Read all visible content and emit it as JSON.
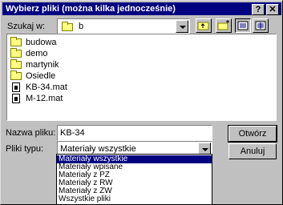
{
  "window": {
    "title": "Wybierz pliki (można kilka jednocześnie)",
    "help_btn": "?",
    "close_btn": "✕"
  },
  "lookin": {
    "label": "Szukaj w:",
    "value": "b"
  },
  "files": [
    {
      "name": "budowa",
      "type": "folder"
    },
    {
      "name": "demo",
      "type": "folder"
    },
    {
      "name": "martynik",
      "type": "folder"
    },
    {
      "name": "Osiedle",
      "type": "folder"
    },
    {
      "name": "KB-34.mat",
      "type": "file"
    },
    {
      "name": "M-12.mat",
      "type": "file"
    }
  ],
  "filename": {
    "label": "Nazwa pliku:",
    "value": "KB-34"
  },
  "filetype": {
    "label": "Pliki typu:",
    "value": "Materiały wszystkie"
  },
  "buttons": {
    "open": "Otwórz",
    "cancel": "Anuluj"
  },
  "type_options": [
    "Materiały wszystkie",
    "Materiały wpisane",
    "Materiały z PZ",
    "Materiały z RW",
    "Materiały z ZW",
    "Wszystkie pliki"
  ]
}
